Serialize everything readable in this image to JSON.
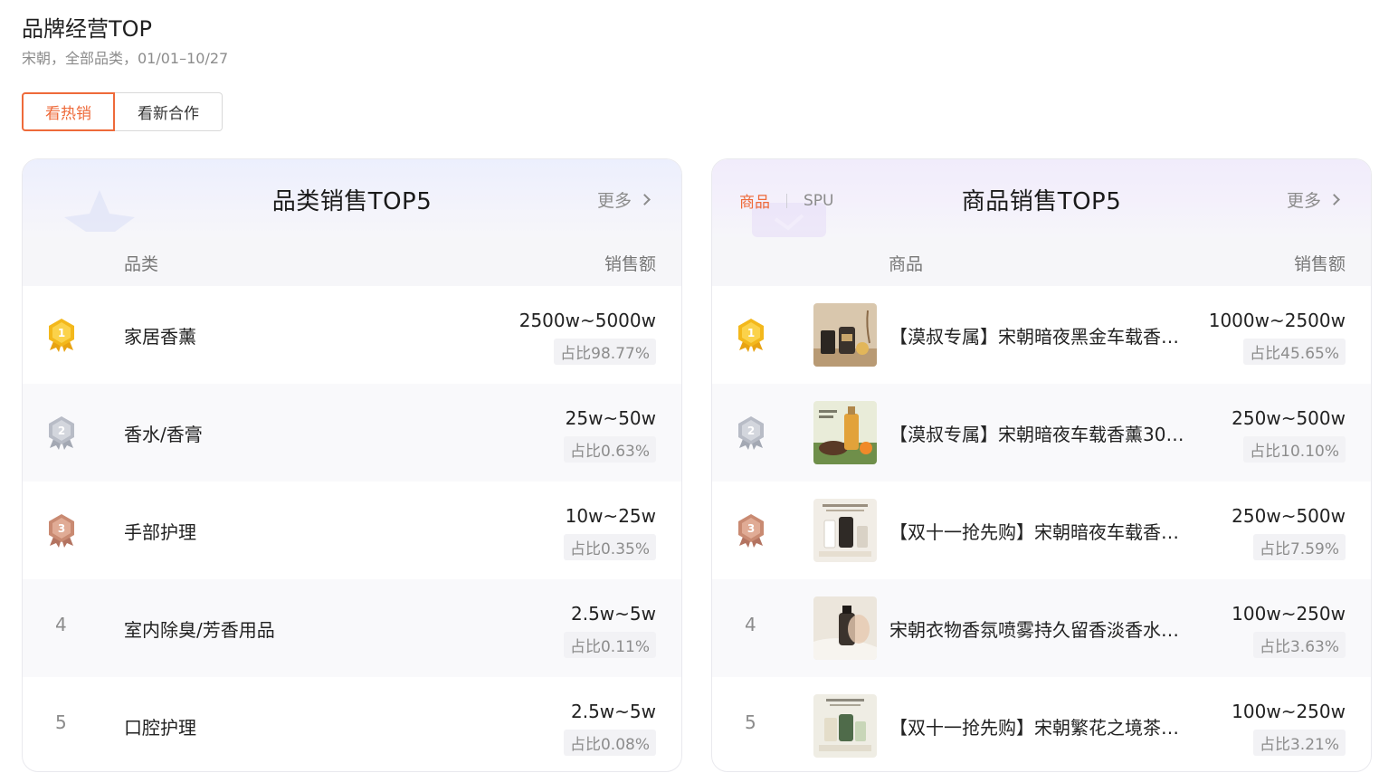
{
  "page": {
    "title": "品牌经营TOP",
    "subtitle": "宋朝，全部品类，01/01–10/27",
    "toggle": {
      "active": "看热销",
      "inactive": "看新合作"
    }
  },
  "left_card": {
    "title": "品类销售TOP5",
    "more": "更多",
    "col_category": "品类",
    "col_sales": "销售额",
    "rows": [
      {
        "rank": "1",
        "name": "家居香薰",
        "amount": "2500w~5000w",
        "share": "占比98.77%"
      },
      {
        "rank": "2",
        "name": "香水/香膏",
        "amount": "25w~50w",
        "share": "占比0.63%"
      },
      {
        "rank": "3",
        "name": "手部护理",
        "amount": "10w~25w",
        "share": "占比0.35%"
      },
      {
        "rank": "4",
        "name": "室内除臭/芳香用品",
        "amount": "2.5w~5w",
        "share": "占比0.11%"
      },
      {
        "rank": "5",
        "name": "口腔护理",
        "amount": "2.5w~5w",
        "share": "占比0.08%"
      }
    ]
  },
  "right_card": {
    "tab_active": "商品",
    "tab_inactive": "SPU",
    "title": "商品销售TOP5",
    "more": "更多",
    "col_product": "商品",
    "col_sales": "销售额",
    "rows": [
      {
        "rank": "1",
        "name": "【漠叔专属】宋朝暗夜黑金车载香…",
        "amount": "1000w~2500w",
        "share": "占比45.65%"
      },
      {
        "rank": "2",
        "name": "【漠叔专属】宋朝暗夜车载香薰30…",
        "amount": "250w~500w",
        "share": "占比10.10%"
      },
      {
        "rank": "3",
        "name": "【双十一抢先购】宋朝暗夜车载香…",
        "amount": "250w~500w",
        "share": "占比7.59%"
      },
      {
        "rank": "4",
        "name": "宋朝衣物香氛喷雾持久留香淡香水…",
        "amount": "100w~250w",
        "share": "占比3.63%"
      },
      {
        "rank": "5",
        "name": "【双十一抢先购】宋朝繁花之境茶…",
        "amount": "100w~250w",
        "share": "占比3.21%"
      }
    ]
  },
  "colors": {
    "accent": "#ee6a3a",
    "gold": "#f3b81c",
    "silver": "#b8bcc6",
    "bronze": "#c98a72"
  },
  "icons": [
    "gold-medal-icon",
    "silver-medal-icon",
    "bronze-medal-icon",
    "chevron-right-icon"
  ]
}
